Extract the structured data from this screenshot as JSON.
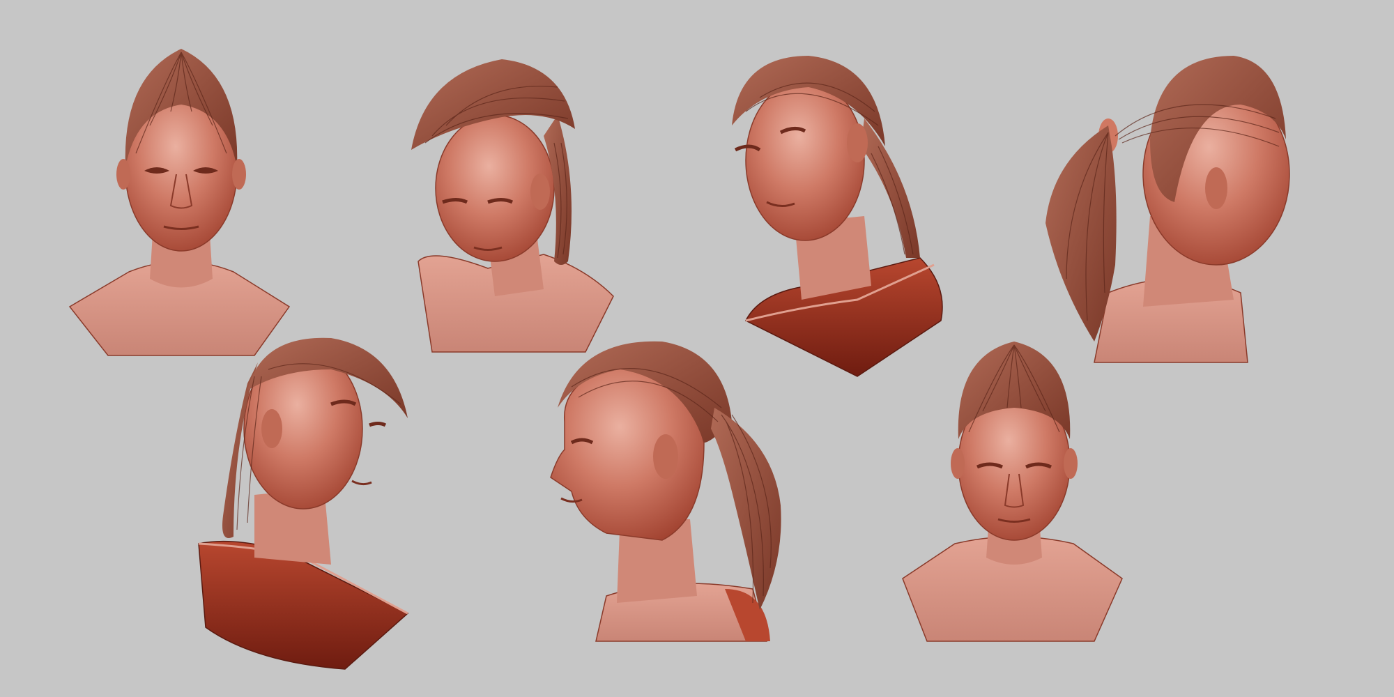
{
  "scene": {
    "background_color": "#c6c6c6",
    "clay_color": "#b8523e",
    "clay_light": "#e3a393",
    "clay_dark": "#7d2a1c",
    "hair_color": "#98503e",
    "hair_line_color": "#5c261a"
  },
  "busts": [
    {
      "name": "bust-front",
      "view": "front",
      "ponytail": false
    },
    {
      "name": "bust-three-quarter-looking-down",
      "view": "three-quarter-down",
      "ponytail": true
    },
    {
      "name": "bust-tilted-left-low-angle",
      "view": "tilted-low-angle",
      "ponytail": true
    },
    {
      "name": "bust-back-three-quarter",
      "view": "back-three-quarter",
      "ponytail": true
    },
    {
      "name": "bust-looking-up-low-angle",
      "view": "looking-up",
      "ponytail": true
    },
    {
      "name": "bust-left-profile",
      "view": "profile",
      "ponytail": true
    },
    {
      "name": "bust-front-high-angle",
      "view": "front-high-angle",
      "ponytail": false
    }
  ]
}
